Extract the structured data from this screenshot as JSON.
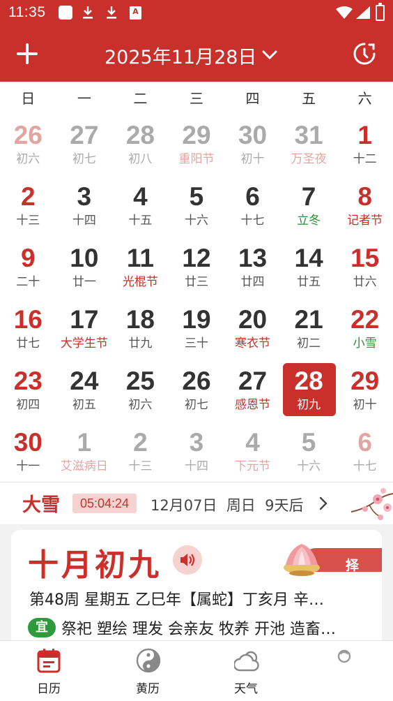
{
  "status": {
    "time": "11:35",
    "notif_badge": "A"
  },
  "header": {
    "title": "2025年11月28日"
  },
  "weekdays": [
    "日",
    "一",
    "二",
    "三",
    "四",
    "五",
    "六"
  ],
  "weeks": [
    [
      {
        "day": "26",
        "lunar": "初六"
      },
      {
        "day": "27",
        "lunar": "初七"
      },
      {
        "day": "28",
        "lunar": "初八"
      },
      {
        "day": "29",
        "lunar": "重阳节"
      },
      {
        "day": "30",
        "lunar": "初十"
      },
      {
        "day": "31",
        "lunar": "万圣夜"
      },
      {
        "day": "1",
        "lunar": "十二"
      }
    ],
    [
      {
        "day": "2",
        "lunar": "十三"
      },
      {
        "day": "3",
        "lunar": "十四"
      },
      {
        "day": "4",
        "lunar": "十五"
      },
      {
        "day": "5",
        "lunar": "十六"
      },
      {
        "day": "6",
        "lunar": "十七"
      },
      {
        "day": "7",
        "lunar": "立冬"
      },
      {
        "day": "8",
        "lunar": "记者节"
      }
    ],
    [
      {
        "day": "9",
        "lunar": "二十"
      },
      {
        "day": "10",
        "lunar": "廿一"
      },
      {
        "day": "11",
        "lunar": "光棍节"
      },
      {
        "day": "12",
        "lunar": "廿三"
      },
      {
        "day": "13",
        "lunar": "廿四"
      },
      {
        "day": "14",
        "lunar": "廿五"
      },
      {
        "day": "15",
        "lunar": "廿六"
      }
    ],
    [
      {
        "day": "16",
        "lunar": "廿七"
      },
      {
        "day": "17",
        "lunar": "大学生节"
      },
      {
        "day": "18",
        "lunar": "廿九"
      },
      {
        "day": "19",
        "lunar": "三十"
      },
      {
        "day": "20",
        "lunar": "寒衣节"
      },
      {
        "day": "21",
        "lunar": "初二"
      },
      {
        "day": "22",
        "lunar": "小雪"
      }
    ],
    [
      {
        "day": "23",
        "lunar": "初四"
      },
      {
        "day": "24",
        "lunar": "初五"
      },
      {
        "day": "25",
        "lunar": "初六"
      },
      {
        "day": "26",
        "lunar": "初七"
      },
      {
        "day": "27",
        "lunar": "感恩节"
      },
      {
        "day": "28",
        "lunar": "初九"
      },
      {
        "day": "29",
        "lunar": "初十"
      }
    ],
    [
      {
        "day": "30",
        "lunar": "十一"
      },
      {
        "day": "1",
        "lunar": "艾滋病日"
      },
      {
        "day": "2",
        "lunar": "十三"
      },
      {
        "day": "3",
        "lunar": "十四"
      },
      {
        "day": "4",
        "lunar": "下元节"
      },
      {
        "day": "5",
        "lunar": "十六"
      },
      {
        "day": "6",
        "lunar": "十七"
      }
    ]
  ],
  "solar_term": {
    "name": "大雪",
    "countdown": "05:04:24",
    "date": "12月07日",
    "weekday": "周日",
    "days_left": "9天后"
  },
  "lunar_card": {
    "title": "十月初九",
    "zeji_label": "择吉日",
    "zeji_arrow": "›",
    "info": "第48周 星期五 乙巳年【属蛇】丁亥月 辛…",
    "yi_label": "宜",
    "yi_text": "祭祀 塑绘 理发 会亲友 牧养 开池 造畜…"
  },
  "nav": [
    {
      "label": "日历"
    },
    {
      "label": "黄历"
    },
    {
      "label": "天气"
    }
  ],
  "colors": {
    "accent": "#c9302c",
    "term_green": "#2e8b36",
    "yi_green": "#2e9a3c"
  }
}
